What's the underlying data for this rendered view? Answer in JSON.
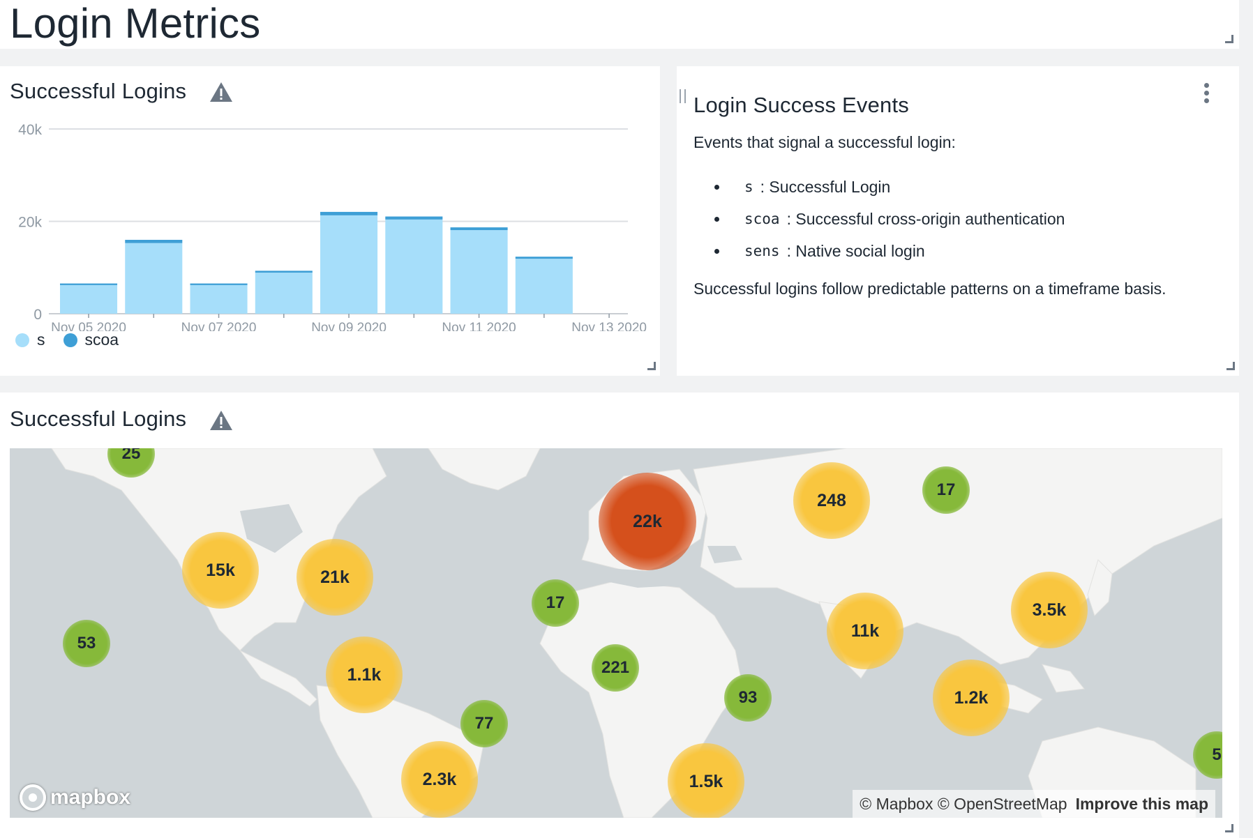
{
  "page": {
    "title": "Login Metrics"
  },
  "chart_panel": {
    "title": "Successful Logins",
    "icon": "warning-icon"
  },
  "chart_data": {
    "type": "bar",
    "stacked": true,
    "categories": [
      "Nov 05 2020",
      "Nov 06 2020",
      "Nov 07 2020",
      "Nov 08 2020",
      "Nov 09 2020",
      "Nov 10 2020",
      "Nov 11 2020",
      "Nov 12 2020",
      "Nov 13 2020"
    ],
    "series": [
      {
        "name": "s",
        "values": [
          6200,
          15300,
          6200,
          8900,
          21300,
          20400,
          18100,
          11900,
          0
        ],
        "color": "#a6defa"
      },
      {
        "name": "scoa",
        "values": [
          350,
          700,
          350,
          400,
          750,
          650,
          600,
          450,
          0
        ],
        "color": "#3e9fd6"
      }
    ],
    "tick_labels_x": [
      "Nov 05 2020",
      "Nov 07 2020",
      "Nov 09 2020",
      "Nov 11 2020",
      "Nov 13 2020"
    ],
    "tick_labels_y": [
      "0",
      "20k",
      "40k"
    ],
    "ylim": [
      0,
      40000
    ],
    "grid": true,
    "legend": "bottom-left"
  },
  "info_panel": {
    "title": "Login Success Events",
    "intro": "Events that signal a successful login:",
    "items": [
      {
        "code": "s",
        "desc": ": Successful Login"
      },
      {
        "code": "scoa",
        "desc": ": Successful cross-origin authentication"
      },
      {
        "code": "sens",
        "desc": ": Native social login"
      }
    ],
    "footer": "Successful logins follow predictable patterns on a timeframe basis."
  },
  "map_panel": {
    "title": "Successful Logins",
    "logo": "mapbox",
    "attribution": "© Mapbox © OpenStreetMap",
    "improve_link": "Improve this map",
    "clusters": [
      {
        "label": "25",
        "level": "green"
      },
      {
        "label": "15k",
        "level": "yellow"
      },
      {
        "label": "21k",
        "level": "yellow"
      },
      {
        "label": "53",
        "level": "green"
      },
      {
        "label": "1.1k",
        "level": "yellow"
      },
      {
        "label": "77",
        "level": "green"
      },
      {
        "label": "2.3k",
        "level": "yellow"
      },
      {
        "label": "17",
        "level": "green"
      },
      {
        "label": "22k",
        "level": "orange"
      },
      {
        "label": "221",
        "level": "green"
      },
      {
        "label": "93",
        "level": "green"
      },
      {
        "label": "1.5k",
        "level": "yellow"
      },
      {
        "label": "248",
        "level": "yellow"
      },
      {
        "label": "17",
        "level": "green"
      },
      {
        "label": "11k",
        "level": "yellow"
      },
      {
        "label": "3.5k",
        "level": "yellow"
      },
      {
        "label": "1.2k",
        "level": "yellow"
      },
      {
        "label": "5",
        "level": "green"
      }
    ]
  }
}
